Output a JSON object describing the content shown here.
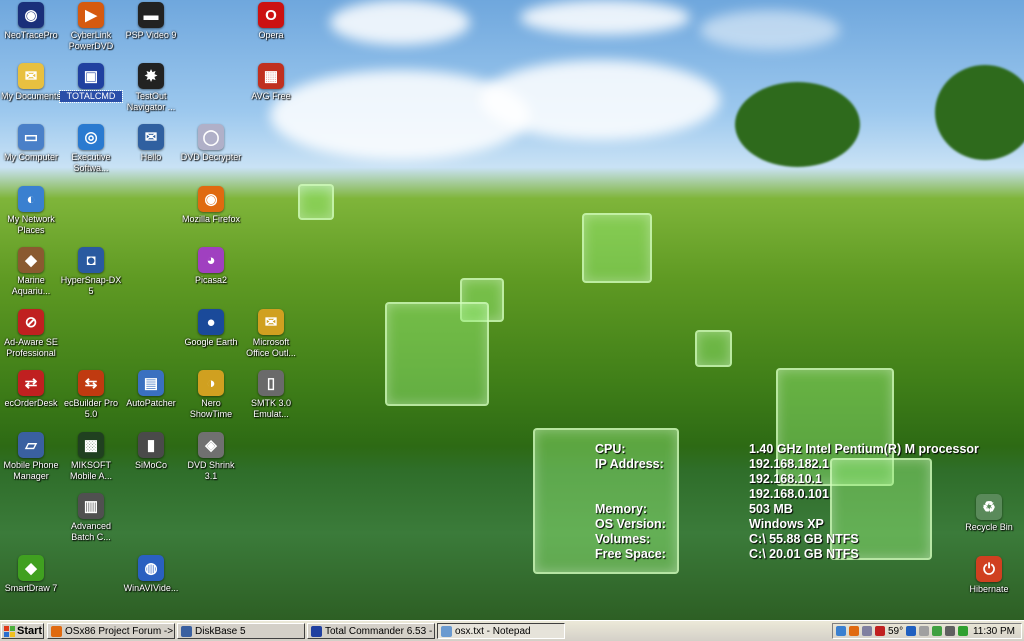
{
  "desktop": {
    "icons": [
      {
        "label": "NeoTracePro",
        "glyph": "◉",
        "color": "#1a2f7a",
        "col": 0,
        "row": 0
      },
      {
        "label": "CyberLink PowerDVD",
        "glyph": "▶",
        "color": "#d65a10",
        "col": 1,
        "row": 0
      },
      {
        "label": "PSP Video 9",
        "glyph": "▬",
        "color": "#222222",
        "col": 2,
        "row": 0
      },
      {
        "label": "Opera",
        "glyph": "O",
        "color": "#cc1111",
        "col": 4,
        "row": 0
      },
      {
        "label": "My Documents",
        "glyph": "✉",
        "color": "#e8c040",
        "col": 0,
        "row": 1
      },
      {
        "label": "TOTALCMD",
        "glyph": "▣",
        "color": "#2040a0",
        "col": 1,
        "row": 1,
        "selected": true
      },
      {
        "label": "TestOut Navigator ...",
        "glyph": "✸",
        "color": "#222222",
        "col": 2,
        "row": 1
      },
      {
        "label": "AVG Free",
        "glyph": "▦",
        "color": "#c03020",
        "col": 4,
        "row": 1
      },
      {
        "label": "My Computer",
        "glyph": "▭",
        "color": "#4a80c8",
        "col": 0,
        "row": 2
      },
      {
        "label": "Executive Softwa...",
        "glyph": "◎",
        "color": "#2a7ad0",
        "col": 1,
        "row": 2
      },
      {
        "label": "Hello",
        "glyph": "✉",
        "color": "#3060a0",
        "col": 2,
        "row": 2
      },
      {
        "label": "DVD Decrypter",
        "glyph": "◯",
        "color": "#b0b0c8",
        "col": 3,
        "row": 2
      },
      {
        "label": "My Network Places",
        "glyph": "◐",
        "color": "#3a80d0",
        "col": 0,
        "row": 3
      },
      {
        "label": "Mozilla Firefox",
        "glyph": "◉",
        "color": "#e06a10",
        "col": 3,
        "row": 3
      },
      {
        "label": "Marine Aquariu...",
        "glyph": "◆",
        "color": "#8a5a30",
        "col": 0,
        "row": 4
      },
      {
        "label": "HyperSnap-DX 5",
        "glyph": "◘",
        "color": "#2a5aa0",
        "col": 1,
        "row": 4
      },
      {
        "label": "Picasa2",
        "glyph": "◕",
        "color": "#a040c0",
        "col": 3,
        "row": 4
      },
      {
        "label": "Ad-Aware SE Professional",
        "glyph": "⊘",
        "color": "#c02020",
        "col": 0,
        "row": 5
      },
      {
        "label": "Google Earth",
        "glyph": "●",
        "color": "#1a4a9a",
        "col": 3,
        "row": 5
      },
      {
        "label": "Microsoft Office Outl...",
        "glyph": "✉",
        "color": "#d0a020",
        "col": 4,
        "row": 5
      },
      {
        "label": "ecOrderDesk",
        "glyph": "⇄",
        "color": "#c02020",
        "col": 0,
        "row": 6
      },
      {
        "label": "ecBuilder Pro 5.0",
        "glyph": "⇆",
        "color": "#c03a10",
        "col": 1,
        "row": 6
      },
      {
        "label": "AutoPatcher",
        "glyph": "▤",
        "color": "#3a70c0",
        "col": 2,
        "row": 6
      },
      {
        "label": "Nero ShowTime",
        "glyph": "◑",
        "color": "#d0a020",
        "col": 3,
        "row": 6
      },
      {
        "label": "SMTK 3.0 Emulat...",
        "glyph": "▯",
        "color": "#6a6a6a",
        "col": 4,
        "row": 6
      },
      {
        "label": "Mobile Phone Manager",
        "glyph": "▱",
        "color": "#3a60a0",
        "col": 0,
        "row": 7
      },
      {
        "label": "MIKSOFT Mobile A...",
        "glyph": "▩",
        "color": "#204020",
        "col": 1,
        "row": 7
      },
      {
        "label": "SiMoCo",
        "glyph": "▮",
        "color": "#4a4a4a",
        "col": 2,
        "row": 7
      },
      {
        "label": "DVD Shrink 3.1",
        "glyph": "◈",
        "color": "#707070",
        "col": 3,
        "row": 7
      },
      {
        "label": "Advanced Batch C...",
        "glyph": "▥",
        "color": "#505050",
        "col": 1,
        "row": 8
      },
      {
        "label": "SmartDraw 7",
        "glyph": "◆",
        "color": "#40a020",
        "col": 0,
        "row": 9
      },
      {
        "label": "WinAVIVide...",
        "glyph": "◍",
        "color": "#2a60c0",
        "col": 2,
        "row": 9
      }
    ],
    "right_icons": [
      {
        "label": "Recycle Bin",
        "glyph": "♻",
        "color": "#5a8a5a"
      },
      {
        "label": "Hibernate",
        "glyph": "⏻",
        "color": "#d04020"
      }
    ]
  },
  "sysinfo": {
    "cpu_label": "CPU:",
    "cpu_value": "1.40 GHz Intel Pentium(R) M processor",
    "ip_label": "IP Address:",
    "ip_values": [
      "192.168.182.1",
      "192.168.10.1",
      "192.168.0.101"
    ],
    "memory_label": "Memory:",
    "memory_value": "503 MB",
    "os_label": "OS Version:",
    "os_value": "Windows XP",
    "volumes_label": "Volumes:",
    "volumes_value": "C:\\ 55.88 GB NTFS",
    "free_label": "Free Space:",
    "free_value": "C:\\ 20.01 GB NTFS"
  },
  "taskbar": {
    "start_label": "Start",
    "tasks": [
      {
        "label": "OSx86 Project Forum -> ...",
        "color": "#e06a10",
        "active": false
      },
      {
        "label": "DiskBase 5",
        "color": "#3a60a0",
        "active": false
      },
      {
        "label": "Total Commander 6.53 - ...",
        "color": "#2040a0",
        "active": false
      },
      {
        "label": "osx.txt - Notepad",
        "color": "#6a9ad0",
        "active": true
      }
    ],
    "tray_temp": "59°",
    "clock": "11:30 PM"
  }
}
